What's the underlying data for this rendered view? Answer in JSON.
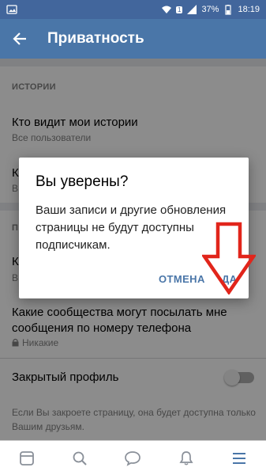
{
  "status_bar": {
    "battery": "37%",
    "time": "18:19",
    "sim": "1"
  },
  "app_bar": {
    "title": "Приватность"
  },
  "sections": {
    "stories_header": "ИСТОРИИ",
    "row1_title": "Кто видит мои истории",
    "row1_value": "Все пользователи",
    "row2_title": "К",
    "row2_value": "В",
    "section2_header": "П",
    "row3_title": "К",
    "row3_value": "В",
    "row4_title": "Какие сообщества могут посылать мне сообщения по номеру телефона",
    "row4_value": "Никакие",
    "row5_title": "Закрытый профиль",
    "row5_note": "Если Вы закроете страницу, она будет доступна только Вашим друзьям."
  },
  "dialog": {
    "title": "Вы уверены?",
    "message": "Ваши записи и другие обновления страницы не будут доступны подписчикам.",
    "cancel": "ОТМЕНА",
    "confirm": "ДА"
  },
  "colors": {
    "brand": "#4a76a8",
    "status": "#42669c",
    "arrow": "#e1251b"
  },
  "bottom_nav": [
    "feed-icon",
    "search-icon",
    "messages-icon",
    "notifications-icon",
    "menu-icon"
  ]
}
